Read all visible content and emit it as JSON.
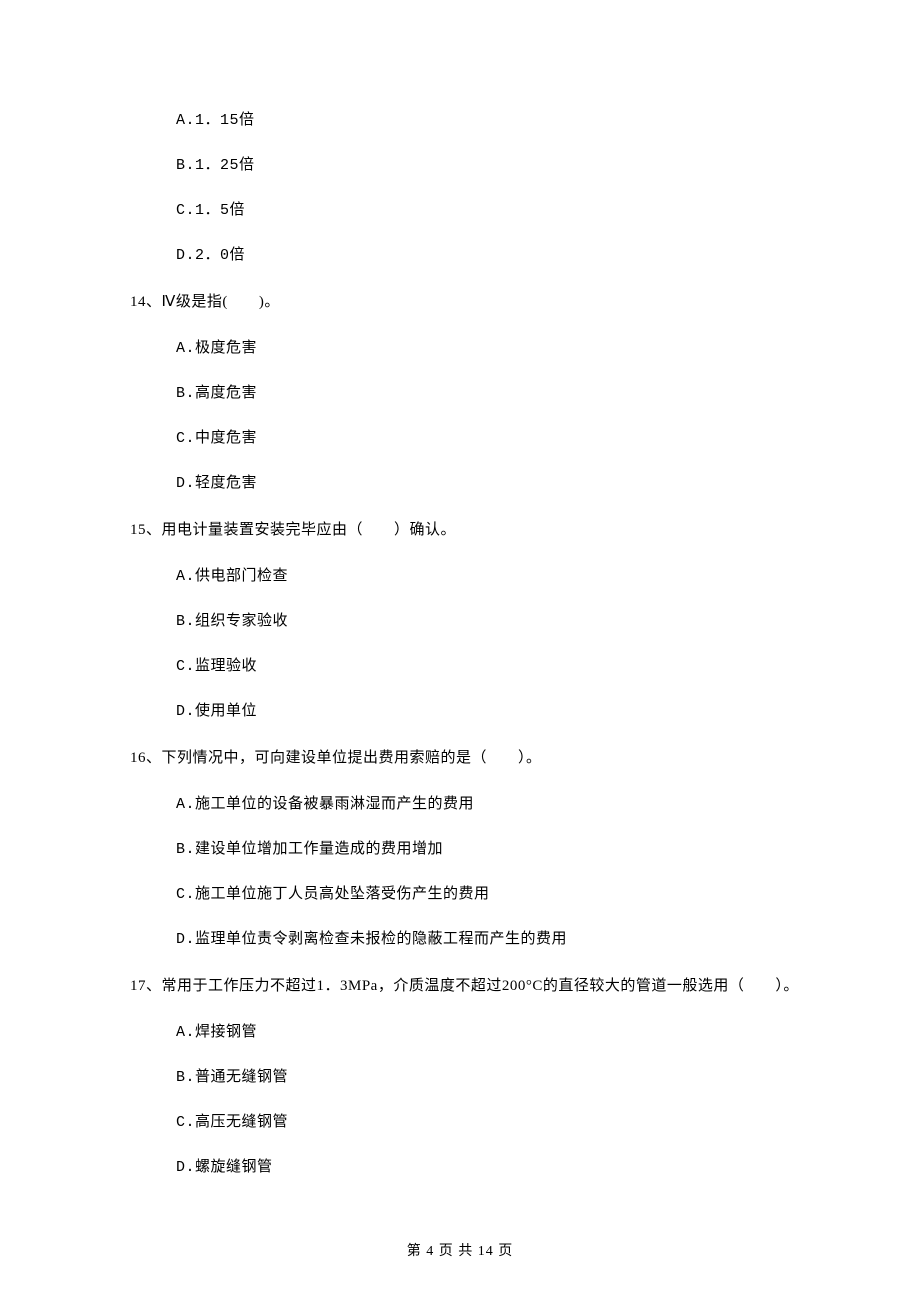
{
  "q13_options": {
    "a": "A.1．15倍",
    "b": "B.1．25倍",
    "c": "C.1．5倍",
    "d": "D.2．0倍"
  },
  "q14": {
    "stem": "14、Ⅳ级是指(　　)。",
    "a": "A.极度危害",
    "b": "B.高度危害",
    "c": "C.中度危害",
    "d": "D.轻度危害"
  },
  "q15": {
    "stem": "15、用电计量装置安装完毕应由（　　）确认。",
    "a": "A.供电部门检查",
    "b": "B.组织专家验收",
    "c": "C.监理验收",
    "d": "D.使用单位"
  },
  "q16": {
    "stem": "16、下列情况中，可向建设单位提出费用索赔的是（　　）。",
    "a": "A.施工单位的设备被暴雨淋湿而产生的费用",
    "b": "B.建设单位增加工作量造成的费用增加",
    "c": "C.施工单位施丁人员高处坠落受伤产生的费用",
    "d": "D.监理单位责令剥离检查未报检的隐蔽工程而产生的费用"
  },
  "q17": {
    "stem": "17、常用于工作压力不超过1．3MPa，介质温度不超过200°C的直径较大的管道一般选用（　　）。",
    "a": "A.焊接钢管",
    "b": "B.普通无缝钢管",
    "c": "C.高压无缝钢管",
    "d": "D.螺旋缝钢管"
  },
  "footer": "第 4 页 共 14 页"
}
